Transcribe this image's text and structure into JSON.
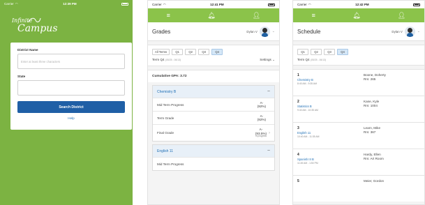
{
  "login": {
    "status": {
      "carrier": "Carrier",
      "time": "12:39 PM"
    },
    "logo": {
      "line1": "Infinite",
      "line2": "Campus"
    },
    "district_label": "District Name",
    "district_placeholder": "Enter at least three characters",
    "state_label": "State",
    "state_value": "",
    "search_button": "Search District",
    "help_link": "Help"
  },
  "grades": {
    "status": {
      "carrier": "Carrier",
      "time": "12:41 PM"
    },
    "title": "Grades",
    "user": "Dylan V",
    "tabs": [
      "All Terms",
      "Q1",
      "Q2",
      "Q3",
      "Q4"
    ],
    "term_label": "Term Q4",
    "term_dates": "(05/25 - 06/13)",
    "settings": "Settings",
    "gpa": "Cumulative GPA: 3.72",
    "courses": [
      {
        "name": "Chemistry B",
        "rows": [
          {
            "label": "Mid Term Progress",
            "grade": "A-",
            "pct": "(92%)",
            "note": ""
          },
          {
            "label": "Term Grade",
            "grade": "A-",
            "pct": "(92%)",
            "note": ""
          },
          {
            "label": "Final Grade",
            "grade": "A-",
            "pct": "(93.5%)",
            "note": "In progress"
          }
        ]
      },
      {
        "name": "English 11",
        "rows": [
          {
            "label": "Mid Term Progress",
            "grade": "",
            "pct": "",
            "note": ""
          }
        ]
      }
    ]
  },
  "schedule": {
    "status": {
      "carrier": "Carrier",
      "time": "12:42 PM"
    },
    "title": "Schedule",
    "user": "Dylan V",
    "tabs": [
      "Q1",
      "Q2",
      "Q3",
      "Q4"
    ],
    "term_label": "Term Q4",
    "term_dates": "(05/25 - 06/13)",
    "periods": [
      {
        "num": "1",
        "course": "Chemistry B",
        "time": "8:40 AM - 9:35 AM",
        "teacher": "Boone, Doherty",
        "room": "Rm: 265"
      },
      {
        "num": "2",
        "course": "Statistics B",
        "time": "9:40 AM - 10:35 AM",
        "teacher": "Kane, Kyle",
        "room": "Rm: 1004"
      },
      {
        "num": "3",
        "course": "English 11",
        "time": "10:40 AM - 11:35 AM",
        "teacher": "Learn, Mike",
        "room": "Rm: 367"
      },
      {
        "num": "4",
        "course": "Spanish III B",
        "time": "11:45 AM - 1:50 PM",
        "teacher": "Hardy, Ellen",
        "room": "Rm: Art Room"
      },
      {
        "num": "5",
        "course": "",
        "time": "",
        "teacher": "Meier, Gordon",
        "room": ""
      }
    ]
  }
}
